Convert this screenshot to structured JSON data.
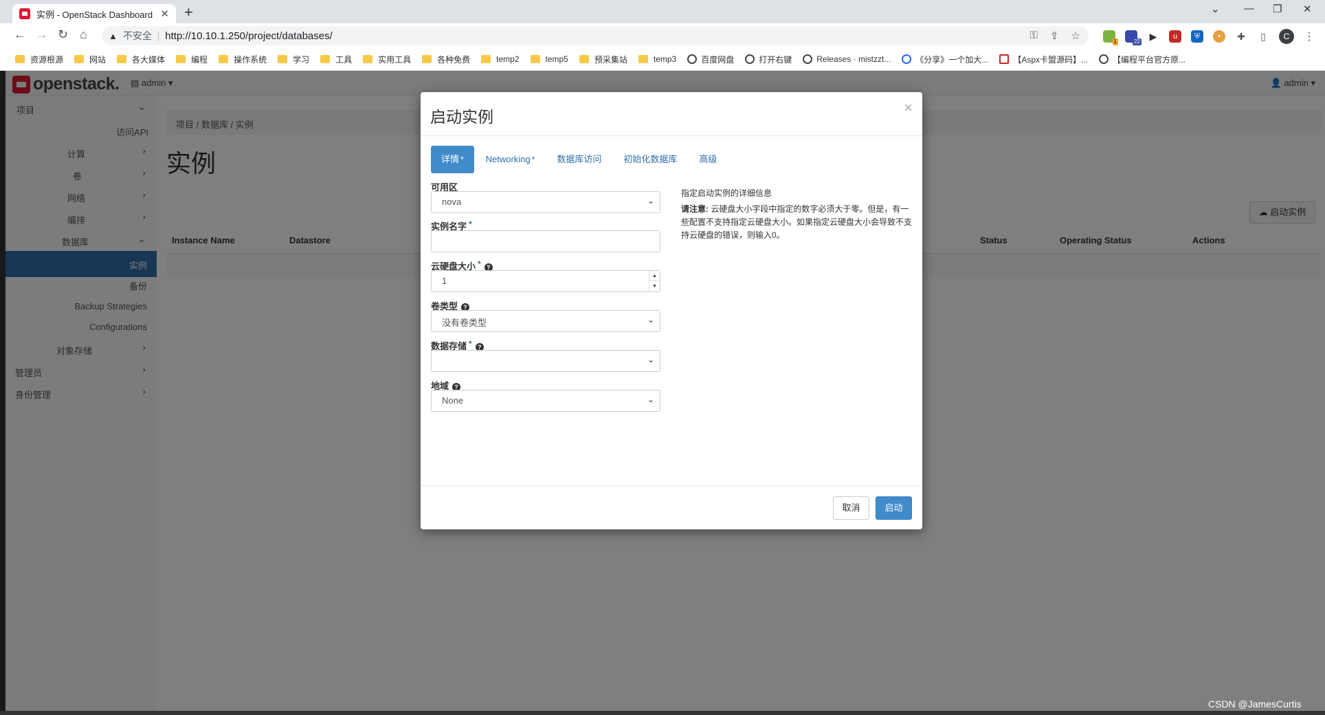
{
  "browser": {
    "tab_title": "实例 - OpenStack Dashboard",
    "insecure_label": "不安全",
    "url": "http://10.10.1.250/project/databases/",
    "profile_initial": "C",
    "ext_badges": [
      "1",
      "22"
    ],
    "bookmarks": [
      {
        "label": "资源根源",
        "icon": "folder-icon"
      },
      {
        "label": "网站",
        "icon": "folder-icon"
      },
      {
        "label": "各大媒体",
        "icon": "folder-icon"
      },
      {
        "label": "编程",
        "icon": "folder-icon"
      },
      {
        "label": "操作系统",
        "icon": "folder-icon"
      },
      {
        "label": "学习",
        "icon": "folder-icon"
      },
      {
        "label": "工具",
        "icon": "folder-icon"
      },
      {
        "label": "实用工具",
        "icon": "folder-icon"
      },
      {
        "label": "各种免费",
        "icon": "folder-icon"
      },
      {
        "label": "temp2",
        "icon": "folder-icon"
      },
      {
        "label": "temp5",
        "icon": "folder-icon"
      },
      {
        "label": "预采集站",
        "icon": "folder-icon"
      },
      {
        "label": "temp3",
        "icon": "folder-icon"
      },
      {
        "label": "百度网盘",
        "icon": "globe-icon"
      },
      {
        "label": "打开右键",
        "icon": "globe-icon"
      },
      {
        "label": "Releases · mistzzt...",
        "icon": "github-icon"
      },
      {
        "label": "《分享》一个加大...",
        "icon": "baidu-icon"
      },
      {
        "label": "【Aspx卡盟源码】...",
        "icon": "site-icon"
      },
      {
        "label": "【编程平台官方原...",
        "icon": "globe-icon"
      }
    ]
  },
  "app": {
    "logo_text": "openstack.",
    "project_switch": "admin ▾",
    "user_menu": "admin ▾",
    "sidebar": {
      "project": "项目",
      "access_api": "访问API",
      "compute": "计算",
      "volumes": "卷",
      "network": "网络",
      "orchestration": "编排",
      "database": "数据库",
      "instances": "实例",
      "backups": "备份",
      "backup_strategies": "Backup Strategies",
      "configurations": "Configurations",
      "object_store": "对象存储",
      "admin": "管理员",
      "identity": "身份管理"
    },
    "breadcrumb": "项目 /  数据库 /  实例",
    "page_title": "实例",
    "launch_button": "启动实例",
    "table_headers": [
      "Instance Name",
      "Datastore",
      "Status",
      "Operating Status",
      "Actions"
    ]
  },
  "modal": {
    "title": "启动实例",
    "close": "×",
    "tabs": [
      {
        "label": "详情",
        "required": "*"
      },
      {
        "label": "Networking",
        "required": "*"
      },
      {
        "label": "数据库访问",
        "required": ""
      },
      {
        "label": "初始化数据库",
        "required": ""
      },
      {
        "label": "高级",
        "required": ""
      }
    ],
    "fields": {
      "az_label": "可用区",
      "az_value": "nova",
      "name_label": "实例名字",
      "name_value": "",
      "disk_label": "云硬盘大小",
      "disk_value": "1",
      "voltype_label": "卷类型",
      "voltype_value": "没有卷类型",
      "datastore_label": "数据存储",
      "datastore_value": "",
      "locality_label": "地域",
      "locality_value": "None",
      "required_mark": "*"
    },
    "help_intro": "指定启动实例的详细信息",
    "help_note_label": "请注意:",
    "help_note_text": " 云硬盘大小字段中指定的数字必须大于零。但是，有一些配置不支持指定云硬盘大小。如果指定云硬盘大小会导致不支持云硬盘的错误，则输入0。",
    "cancel": "取消",
    "submit": "启动"
  },
  "watermark": "CSDN @JamesCurtis"
}
